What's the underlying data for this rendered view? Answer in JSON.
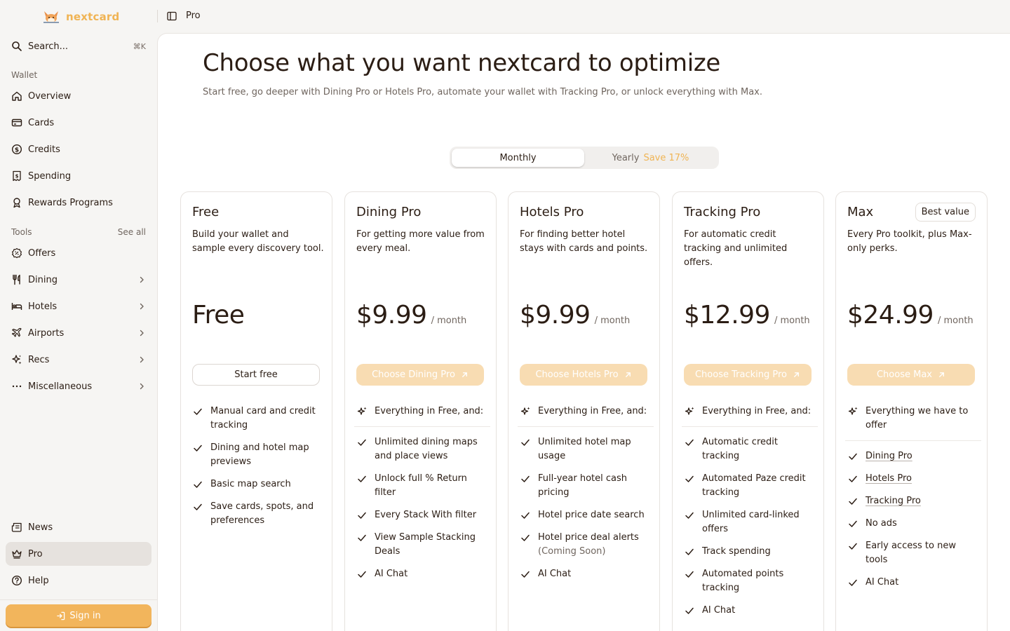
{
  "brand": {
    "name": "nextcard"
  },
  "search": {
    "label": "Search...",
    "shortcut": "⌘K"
  },
  "sidebar": {
    "wallet_label": "Wallet",
    "wallet": [
      {
        "label": "Overview",
        "icon": "home-icon"
      },
      {
        "label": "Cards",
        "icon": "credit-card-icon"
      },
      {
        "label": "Credits",
        "icon": "dollar-circle-icon"
      },
      {
        "label": "Spending",
        "icon": "receipt-icon"
      },
      {
        "label": "Rewards Programs",
        "icon": "award-icon"
      }
    ],
    "tools_label": "Tools",
    "see_all": "See all",
    "tools": [
      {
        "label": "Offers",
        "icon": "badge-percent-icon"
      },
      {
        "label": "Dining",
        "icon": "utensils-icon"
      },
      {
        "label": "Hotels",
        "icon": "bed-icon"
      },
      {
        "label": "Airports",
        "icon": "plane-icon"
      },
      {
        "label": "Recs",
        "icon": "sparkles-icon"
      },
      {
        "label": "Miscellaneous",
        "icon": "more-horizontal-icon"
      }
    ],
    "bottom": [
      {
        "label": "News",
        "icon": "newspaper-icon"
      },
      {
        "label": "Pro",
        "icon": "crown-icon"
      },
      {
        "label": "Help",
        "icon": "help-circle-icon"
      }
    ],
    "sign_in": "Sign in"
  },
  "topbar": {
    "breadcrumb": "Pro"
  },
  "page": {
    "title": "Choose what you want nextcard to optimize",
    "subtitle": "Start free, go deeper with Dining Pro or Hotels Pro, automate your wallet with Tracking Pro, or unlock everything with Max."
  },
  "billing_toggle": {
    "monthly": "Monthly",
    "yearly": "Yearly",
    "yearly_save": "Save 17%",
    "selected": "Monthly"
  },
  "plans": [
    {
      "name": "Free",
      "description": "Build your wallet and sample every discovery tool.",
      "price": "Free",
      "per": "",
      "cta": "Start free",
      "features": [
        "Manual card and credit tracking",
        "Dining and hotel map previews",
        "Basic map search",
        "Save cards, spots, and preferences"
      ]
    },
    {
      "name": "Dining Pro",
      "description": "For getting more value from every meal.",
      "price": "$9.99",
      "per": "/ month",
      "cta": "Choose Dining Pro",
      "header": "Everything in Free, and:",
      "features": [
        "Unlimited dining maps and place views",
        "Unlock full % Return filter",
        "Every Stack With filter",
        "View Sample Stacking Deals",
        "AI Chat"
      ]
    },
    {
      "name": "Hotels Pro",
      "description": "For finding better hotel stays with cards and points.",
      "price": "$9.99",
      "per": "/ month",
      "cta": "Choose Hotels Pro",
      "header": "Everything in Free, and:",
      "features": [
        "Unlimited hotel map usage",
        "Full-year hotel cash pricing",
        "Hotel price date search",
        "Hotel price deal alerts",
        "AI Chat"
      ],
      "feature_note": "(Coming Soon)"
    },
    {
      "name": "Tracking Pro",
      "description": "For automatic credit tracking and unlimited offers.",
      "price": "$12.99",
      "per": "/ month",
      "cta": "Choose Tracking Pro",
      "header": "Everything in Free, and:",
      "features": [
        "Automatic credit tracking",
        "Automated Paze credit tracking",
        "Unlimited card-linked offers",
        "Track spending",
        "Automated points tracking",
        "AI Chat"
      ]
    },
    {
      "name": "Max",
      "badge": "Best value",
      "description": "Every Pro toolkit, plus Max-only perks.",
      "price": "$24.99",
      "per": "/ month",
      "cta": "Choose Max",
      "header": "Everything we have to offer",
      "features": [
        "Dining Pro",
        "Hotels Pro",
        "Tracking Pro",
        "No ads",
        "Early access to new tools",
        "AI Chat"
      ]
    }
  ],
  "colors": {
    "accent": "#f2b55c",
    "accent_light": "#f8dcb2",
    "text": "#2b1d14",
    "muted": "#6f655e"
  }
}
